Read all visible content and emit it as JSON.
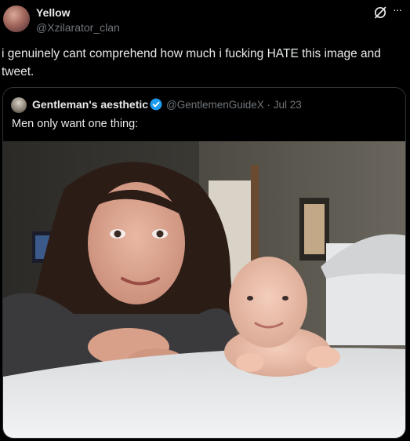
{
  "author": {
    "name": "Yellow",
    "handle": "@Xzilarator_clan",
    "avatar_icon": "user-avatar-icon"
  },
  "header_actions": {
    "grok_icon": "grok-icon",
    "more_icon": "more-dots-icon",
    "more_label": "···"
  },
  "tweet": {
    "text": "i genuinely cant comprehend how much i fucking HATE this image and tweet."
  },
  "quoted_tweet": {
    "name": "Gentleman's aesthetic",
    "handle_date": "@GentlemenGuideX · Jul 23",
    "text": "Men only want one thing:",
    "verified_color": "#1d9bf0"
  },
  "theme": {
    "background": "#000000",
    "text_primary": "#e7e9ea",
    "text_secondary": "#71767b",
    "border": "#2f3336"
  }
}
